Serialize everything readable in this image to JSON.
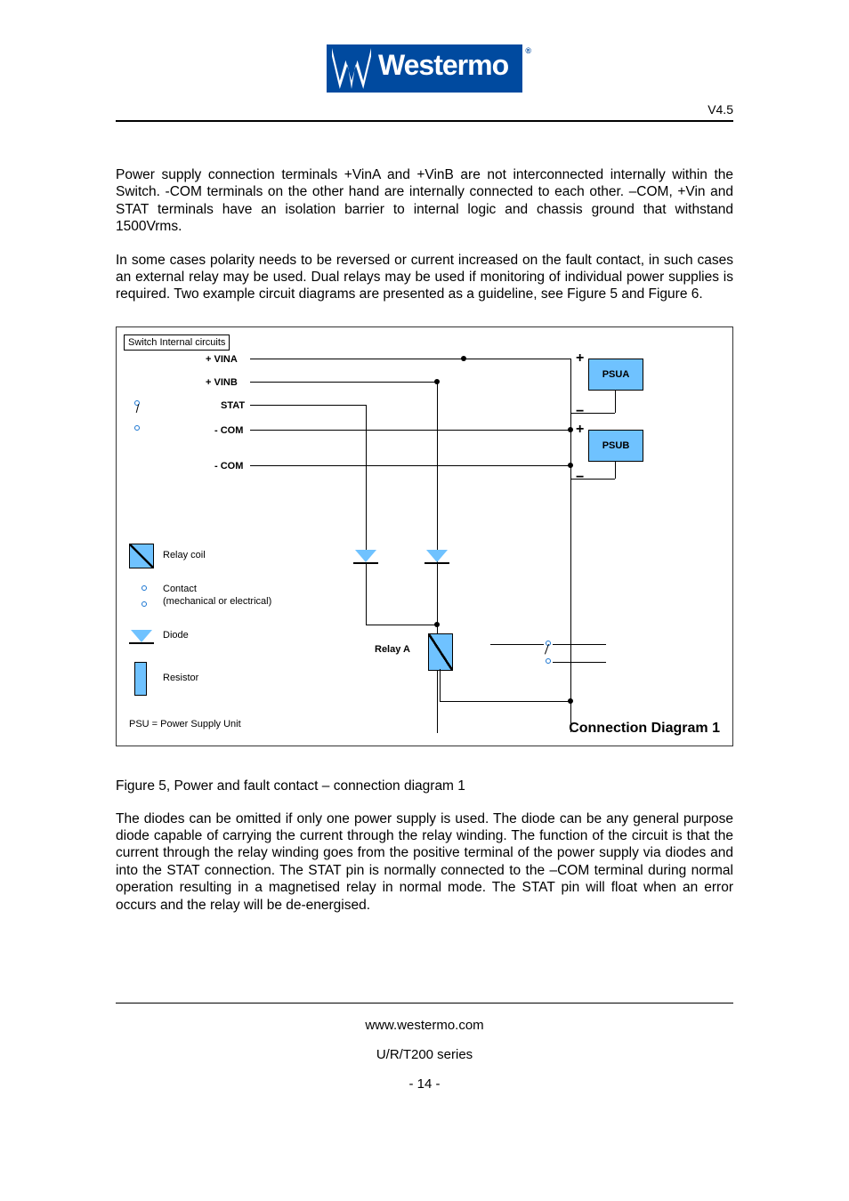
{
  "header": {
    "brand": "Westermo",
    "version": "V4.5"
  },
  "paragraphs": {
    "p1": "Power supply connection terminals +VinA and +VinB are not interconnected internally within the Switch.  -COM terminals on the other hand are internally connected to each other. –COM, +Vin and STAT terminals have an isolation barrier to internal logic and chassis ground that withstand 1500Vrms.",
    "p2": "In some cases polarity needs to be reversed or current increased on the fault contact, in such cases an external relay may be used. Dual relays may be used if monitoring of individual power supplies is required. Two example circuit diagrams are presented as a guideline, see Figure 5 and Figure 6.",
    "p3": "The diodes can be omitted if only one power supply is used. The diode can be any general purpose diode capable of carrying the current through the relay winding. The function of the circuit is that the current through the relay winding goes from the positive terminal of the power supply via diodes and into the STAT connection. The STAT pin is normally connected to the –COM terminal during normal operation resulting in a magnetised relay in normal mode. The STAT pin will float when an error occurs and the relay will be de-energised."
  },
  "diagram": {
    "internal_box": "Switch Internal circuits",
    "terminals": {
      "vina": "+ VINA",
      "vinb": "+ VINB",
      "stat": "STAT",
      "com1": "- COM",
      "com2": "- COM"
    },
    "psu_a": "PSUA",
    "psu_b": "PSUB",
    "relay_a": "Relay A",
    "legend": {
      "relay_coil": "Relay coil",
      "contact": "Contact",
      "contact_sub": "(mechanical or electrical)",
      "diode": "Diode",
      "resistor": "Resistor",
      "psu_note": "PSU = Power Supply Unit"
    },
    "title": "Connection Diagram 1"
  },
  "caption": "Figure 5, Power and fault contact – connection diagram 1",
  "footer": {
    "url": "www.westermo.com",
    "series": "U/R/T200 series",
    "page": "- 14 -"
  }
}
